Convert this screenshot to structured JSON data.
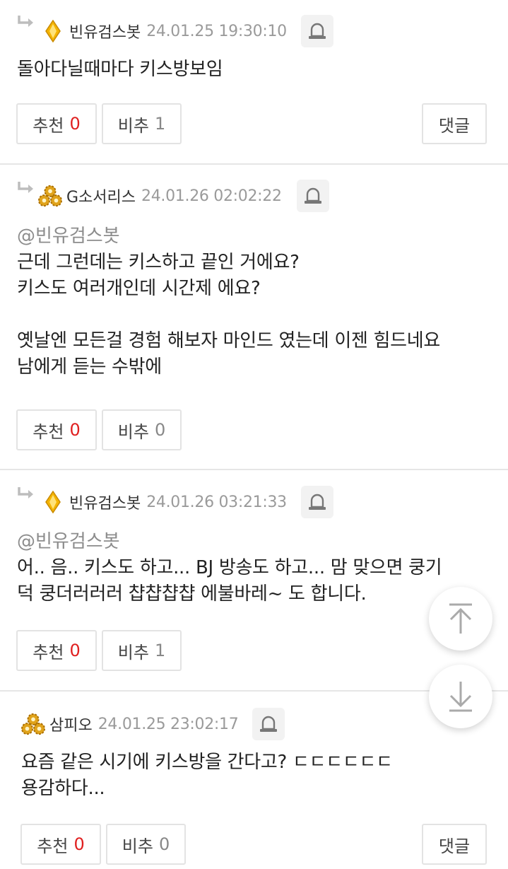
{
  "colors": {
    "accent_red": "#e02020",
    "muted": "#9a9a9a",
    "border": "#e3e3e3"
  },
  "comments": [
    {
      "nickname": "빈유검스봇",
      "time": "24.01.25 19:30:10",
      "mention": "",
      "body": "돌아다닐때마다 키스방보임",
      "recommend_label": "추천",
      "recommend_count": "0",
      "oppose_label": "비추",
      "oppose_count": "1",
      "reply_label": "댓글"
    },
    {
      "nickname": "G소서리스",
      "time": "24.01.26 02:02:22",
      "mention": "@빈유검스봇",
      "body": "근데 그런데는 키스하고 끝인 거에요?\n키스도 여러개인데 시간제 에요?\n\n옛날엔 모든걸 경험 해보자 마인드 였는데 이젠 힘드네요\n남에게 듣는 수밖에",
      "recommend_label": "추천",
      "recommend_count": "0",
      "oppose_label": "비추",
      "oppose_count": "0"
    },
    {
      "nickname": "빈유검스봇",
      "time": "24.01.26 03:21:33",
      "mention": "@빈유검스봇",
      "body": "어.. 음.. 키스도 하고... BJ 방송도 하고... 맘 맞으면 쿵기\n덕 쿵더러러러 챱챱챱챱 에불바레~ 도 합니다.",
      "recommend_label": "추천",
      "recommend_count": "0",
      "oppose_label": "비추",
      "oppose_count": "1"
    },
    {
      "nickname": "삼피오",
      "time": "24.01.25 23:02:17",
      "mention": "",
      "body": "요즘 같은 시기에 키스방을 간다고? ㄷㄷㄷㄷㄷㄷ\n용감하다...",
      "recommend_label": "추천",
      "recommend_count": "0",
      "oppose_label": "비추",
      "oppose_count": "0",
      "reply_label": "댓글"
    }
  ],
  "icons": {
    "reply_arrow": "reply-arrow-icon",
    "report": "report-siren-icon",
    "badge_diamond": "diamond-badge-icon",
    "badge_gear": "gold-gears-badge-icon",
    "scroll_top": "scroll-to-top-icon",
    "scroll_bottom": "scroll-to-bottom-icon"
  }
}
